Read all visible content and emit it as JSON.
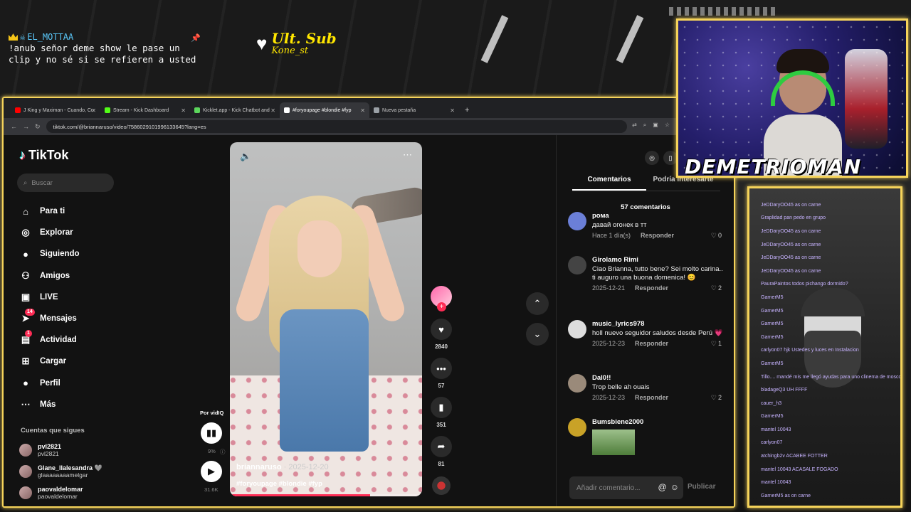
{
  "overlay": {
    "chat_user": "EL_MOTTAA",
    "chat_message": "!anub señor deme show le pase un clip y no sé si se refieren a usted",
    "sub_title": "Ult. Sub",
    "sub_name": "Kone_st"
  },
  "browser": {
    "tabs": [
      {
        "label": "J King y Maximan - Cuando, Cu",
        "color": "#ff0000",
        "active": false
      },
      {
        "label": "Stream - Kick Dashboard",
        "color": "#53fc18",
        "active": false
      },
      {
        "label": "Kicklet.app - Kick Chatbot and",
        "color": "#5cd65c",
        "active": false
      },
      {
        "label": "#foryoupage #blondie #fyp",
        "color": "#ffffff",
        "active": true
      },
      {
        "label": "Nueva pestaña",
        "color": "#9aa0a6",
        "active": false
      }
    ],
    "url": "tiktok.com/@briannaruso/video/7586029101996133645?lang=es"
  },
  "tiktok": {
    "logo": "TikTok",
    "search_placeholder": "Buscar",
    "nav": [
      {
        "label": "Para ti",
        "icon": "home-icon",
        "badge": ""
      },
      {
        "label": "Explorar",
        "icon": "compass-icon",
        "badge": ""
      },
      {
        "label": "Siguiendo",
        "icon": "following-icon",
        "badge": ""
      },
      {
        "label": "Amigos",
        "icon": "friends-icon",
        "badge": ""
      },
      {
        "label": "LIVE",
        "icon": "live-icon",
        "badge": ""
      },
      {
        "label": "Mensajes",
        "icon": "messages-icon",
        "badge": "14"
      },
      {
        "label": "Actividad",
        "icon": "activity-icon",
        "badge": "1"
      },
      {
        "label": "Cargar",
        "icon": "upload-icon",
        "badge": ""
      },
      {
        "label": "Perfil",
        "icon": "profile-icon",
        "badge": ""
      },
      {
        "label": "Más",
        "icon": "more-icon",
        "badge": ""
      }
    ],
    "following_title": "Cuentas que sigues",
    "following": [
      {
        "name": "pvl2821",
        "sub": "pvl2821"
      },
      {
        "name": "Glane_llalesandra 🩶",
        "sub": "glaaaaaaaamelgar"
      },
      {
        "name": "paovaldelomar",
        "sub": "paovaldelomar"
      }
    ],
    "vidiq": {
      "label": "Por vidIQ",
      "percent": "9%",
      "views": "31.6K"
    },
    "video": {
      "username": "briannaruso",
      "date": "· 2025-12-20",
      "tags": "#foryoupage #blondie #fyp",
      "progress": 0.73
    },
    "actions": {
      "likes": "2840",
      "comments": "57",
      "saves": "351",
      "shares": "81"
    },
    "comments_panel": {
      "tab_comments": "Comentarios",
      "tab_interest": "Podría interesarte",
      "count": "57 comentarios",
      "reply_label": "Responder",
      "input_placeholder": "Añadir comentario...",
      "publish": "Publicar",
      "items": [
        {
          "user": "рома",
          "text": "давай огонек в тт",
          "date": "Hace 1 día(s)",
          "likes": "0"
        },
        {
          "user": "Girolamo Rimi",
          "text": "Ciao Brianna, tutto bene? Sei molto carina.. ti auguro una buona domenica! 😊",
          "date": "2025-12-21",
          "likes": "2"
        },
        {
          "user": "music_lyrics978",
          "text": "holl nuevo seguidor saludos desde Perú 💗",
          "date": "2025-12-23",
          "likes": "1"
        },
        {
          "user": "Dal0!!",
          "text": "Trop belle ah ouais",
          "date": "2025-12-23",
          "likes": "2"
        },
        {
          "user": "Bumsbiene2000",
          "text": "",
          "date": "",
          "likes": ""
        }
      ]
    }
  },
  "webcam": {
    "name": "DEMETRIOMAN"
  },
  "side_chat_rows": [
    "JeDDaryOO45 as on carne",
    "Graplidad pan pedo en grupo",
    "JeDDaryOO45 as on carne",
    "JeDDaryOO45 as on carne",
    "JeDDaryOO45 as on carne",
    "JeDDaryOO45 as on carne",
    "PauraPaintos todos pichango dormido?",
    "GarnerM5",
    "GarnerM5",
    "GarnerM5",
    "GarnerM5",
    "carlyon07 hjk Ustedes y luces en Instalacion",
    "GarnerM5",
    "Tillo.... mandé mis me llegó ayudas para uno clinema de mosco a pegar en CA",
    "bladageQ3 UH FFFF",
    "cauer_h3",
    "GarnerM5",
    "mantel 10043",
    "carlyon07",
    "atchingb2v ACABEE FOTTER",
    "mantel 10043 ACASALE FOGADO",
    "mantel 10043",
    "GarnerM5 as on carne"
  ]
}
